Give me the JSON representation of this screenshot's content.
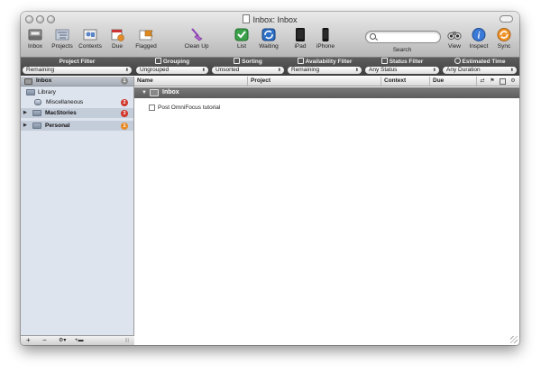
{
  "window": {
    "title": "Inbox: Inbox"
  },
  "toolbar": {
    "items": [
      {
        "id": "inbox",
        "label": "Inbox"
      },
      {
        "id": "projects",
        "label": "Projects"
      },
      {
        "id": "contexts",
        "label": "Contexts"
      },
      {
        "id": "due",
        "label": "Due"
      },
      {
        "id": "flagged",
        "label": "Flagged"
      },
      {
        "id": "cleanup",
        "label": "Clean Up"
      },
      {
        "id": "list",
        "label": "List"
      },
      {
        "id": "waiting",
        "label": "Waiting"
      },
      {
        "id": "ipad",
        "label": "iPad"
      },
      {
        "id": "iphone",
        "label": "iPhone"
      },
      {
        "id": "view",
        "label": "View"
      },
      {
        "id": "inspect",
        "label": "Inspect"
      },
      {
        "id": "sync",
        "label": "Sync"
      }
    ],
    "search": {
      "label": "Search",
      "placeholder": ""
    }
  },
  "filters": [
    {
      "title": "Project Filter",
      "value": "Remaining"
    },
    {
      "title": "Grouping",
      "value": "Ungrouped"
    },
    {
      "title": "Sorting",
      "value": "Unsorted"
    },
    {
      "title": "Availability Filter",
      "value": "Remaining"
    },
    {
      "title": "Status Filter",
      "value": "Any Status"
    },
    {
      "title": "Estimated Time",
      "value": "Any Duration"
    }
  ],
  "sidebar": {
    "items": [
      {
        "label": "Inbox",
        "badge": "1",
        "badge_color": "#8a8a8a"
      },
      {
        "label": "Library",
        "badge": ""
      },
      {
        "label": "Miscellaneous",
        "badge": "2",
        "badge_color": "#d0362b"
      },
      {
        "label": "MacStories",
        "badge": "3",
        "badge_color": "#d0362b"
      },
      {
        "label": "Personal",
        "badge": "1",
        "badge_color": "#e68a25"
      }
    ],
    "bottom": {
      "add": "+",
      "remove": "−",
      "gear": "⚙▾",
      "add_folder": "+▬",
      "handle": "|||"
    }
  },
  "columns": [
    "Name",
    "Project",
    "Context",
    "Due"
  ],
  "column_icons": [
    "repeat-icon",
    "flag-icon",
    "estimate-icon",
    "gear-icon"
  ],
  "group": {
    "label": "Inbox"
  },
  "tasks": [
    {
      "name": "Post OmniFocus tutorial"
    }
  ],
  "colors": {
    "sidebar_bg": "#dde4ee",
    "filterbar_bg": "#4a4a4a",
    "badge_red": "#d0362b",
    "badge_orange": "#e68a25",
    "badge_gray": "#8a8a8a"
  }
}
